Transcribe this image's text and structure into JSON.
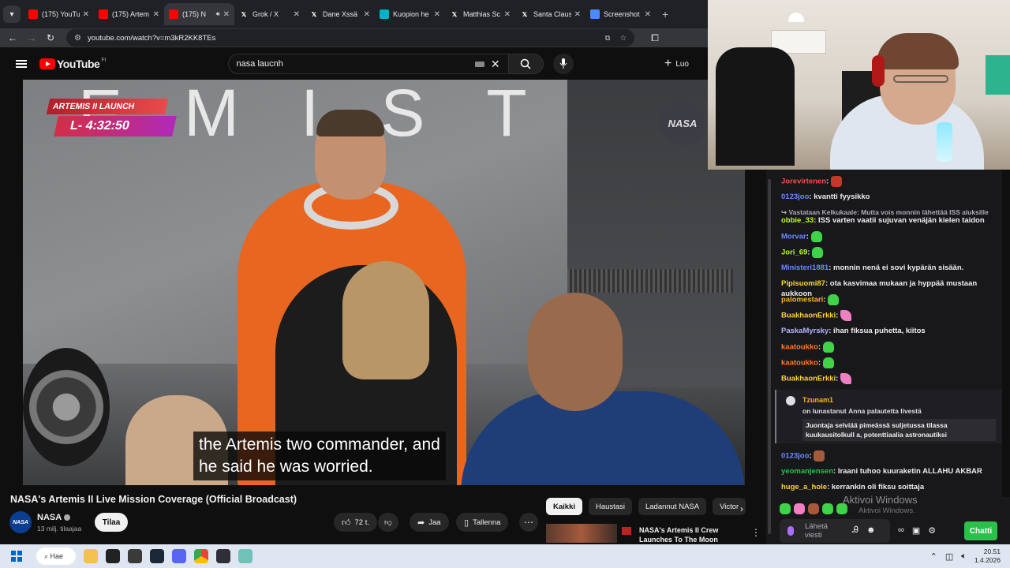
{
  "browser": {
    "tabs": [
      {
        "label": "(175) YouTu",
        "icon": "youtube-icon"
      },
      {
        "label": "(175) Artem",
        "icon": "youtube-icon"
      },
      {
        "label": "(175) N",
        "icon": "youtube-icon",
        "active": true
      },
      {
        "label": "Grok / X",
        "icon": "x-icon"
      },
      {
        "label": "Dane Xssä",
        "icon": "x-icon"
      },
      {
        "label": "Kuopion he",
        "icon": "kuopio-icon"
      },
      {
        "label": "Matthias Sc",
        "icon": "x-icon"
      },
      {
        "label": "Santa Claus",
        "icon": "x-icon"
      },
      {
        "label": "Screenshot",
        "icon": "screenshot-icon"
      }
    ],
    "url": "youtube.com/watch?v=m3kR2KK8TEs"
  },
  "youtube": {
    "logo_text": "YouTube",
    "country_code": "FI",
    "search_query": "nasa laucnh",
    "create_label": "Luo"
  },
  "video": {
    "badge_top": "ARTEMIS II LAUNCH",
    "badge_bottom": "L- 4:32:50",
    "backdrop_letters": "EMISTI",
    "caption_line1": "the Artemis two commander, and",
    "caption_line2": "he said he was worried.",
    "nasa_logo": "NASA",
    "title": "NASA's Artemis II Live Mission Coverage (Official Broadcast)"
  },
  "channel": {
    "name": "NASA",
    "subscribers": "13 milj. tilaajaa",
    "subscribe_label": "Tilaa",
    "like_count": "72 t.",
    "share_label": "Jaa",
    "save_label": "Tallenna"
  },
  "chips": [
    "Kaikki",
    "Haustasi",
    "Ladannut NASA",
    "Victor"
  ],
  "recommendation": {
    "title": "NASA's Artemis II Crew Launches To The Moon (Offici..."
  },
  "chat": {
    "messages": [
      {
        "user": "Jorevirtenen",
        "color": "#ff4a4a",
        "text": "",
        "emote": "e-red"
      },
      {
        "user": "0123joo",
        "color": "#6b8cff",
        "text": "kvantti fyysikko"
      },
      {
        "user": "obbie_33",
        "color": "#b8ff2e",
        "text": "ISS varten vaatii sujuvan venäjän kielen taidon"
      },
      {
        "user": "Morvar",
        "color": "#6b8cff",
        "text": "",
        "emote": "e-green"
      },
      {
        "user": "Jori_69",
        "color": "#b8ff2e",
        "text": "",
        "emote": "e-green"
      },
      {
        "user": "Ministeri1881",
        "color": "#6b8cff",
        "text": "monnin nenä ei sovi kypärän sisään."
      },
      {
        "user": "Pipisuomi87",
        "color": "#ffd23a",
        "text": "ota kasvimaa mukaan ja hyppää mustaan aukkoon"
      },
      {
        "user": "palomestari",
        "color": "#ffb31a",
        "text": "",
        "emote": "e-green"
      },
      {
        "user": "BuakhaonErkki",
        "color": "#ffd23a",
        "text": "",
        "emote": "e-pink"
      },
      {
        "user": "PaskaMyrsky",
        "color": "#b3b3ff",
        "text": "ihan fiksua puhetta, kiitos"
      },
      {
        "user": "kaatoukko",
        "color": "#ff7a2e",
        "text": "",
        "emote": "e-green"
      },
      {
        "user": "kaatoukko",
        "color": "#ff7a2e",
        "text": "",
        "emote": "e-green"
      },
      {
        "user": "BuakhaonErkki",
        "color": "#ffd23a",
        "text": "",
        "emote": "e-pink"
      }
    ],
    "reply_context": "Vastataan Kelkukaale: Mutta vois monnin lähettää ISS aluksille",
    "redeem": {
      "user": "Tzunam1",
      "action_prefix": "on lunastanut",
      "reward": "Anna palautetta livestä",
      "body": "Juontaja selviää pimeässä suljetussa tilassa kuukausitolkull a, potenttiaalia astronautiksi"
    },
    "after_redeem": [
      {
        "user": "0123joo",
        "color": "#6b8cff",
        "text": "",
        "emote": "e-face"
      },
      {
        "user": "yeomanjensen",
        "color": "#2bc04a",
        "text": "Iraani tuhoo kuuraketin ALLAHU AKBAR"
      },
      {
        "user": "huge_a_hole",
        "color": "#ffd23a",
        "text": "kerrankin oli fiksu soittaja"
      }
    ],
    "input_hint_line1": "Lähetä",
    "input_hint_line2": "viesti",
    "send_label": "Chatti"
  },
  "windows": {
    "activate_title": "Aktivoi Windows",
    "activate_sub": "Aktivoi Windows.",
    "search_label": "Hae",
    "time": "20.51",
    "date": "1.4.2026"
  },
  "colors": {
    "youtube_red": "#ff0000",
    "twitch_purple": "#a970ff",
    "chat_button_green": "#2bc04a"
  }
}
